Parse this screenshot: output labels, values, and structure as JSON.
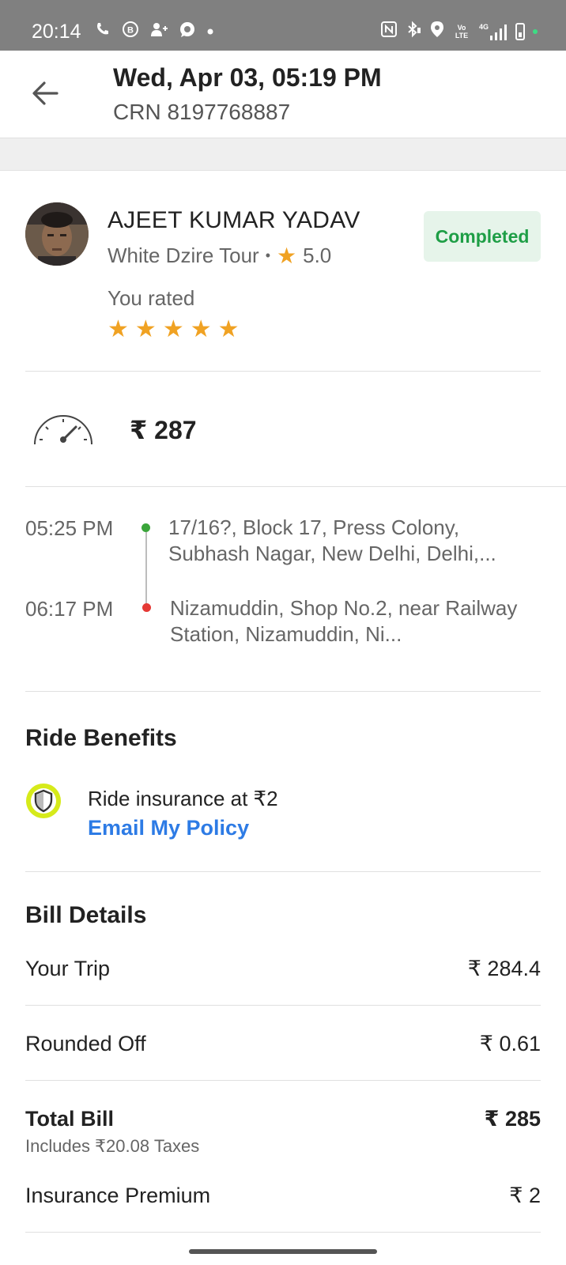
{
  "status_bar": {
    "time": "20:14",
    "icons_left": [
      "phone-icon",
      "b-badge-icon",
      "person-add-icon",
      "whatsapp-icon",
      "dot-icon"
    ],
    "icons_right": [
      "nfc-icon",
      "bluetooth-icon",
      "location-icon",
      "volte-icon",
      "signal-icon",
      "battery-icon"
    ],
    "volte_label": "Vo LTE",
    "network_label": "4G"
  },
  "header": {
    "title": "Wed, Apr 03, 05:19 PM",
    "subtitle": "CRN 8197768887"
  },
  "driver": {
    "name": "AJEET KUMAR YADAV",
    "car": "White Dzire Tour",
    "separator": "•",
    "rating": "5.0",
    "status": "Completed",
    "you_rated_label": "You rated",
    "user_rating_stars": 5
  },
  "fare": {
    "amount": "₹ 287"
  },
  "route": {
    "pickup_time": "05:25 PM",
    "pickup_address": "17/16?, Block 17, Press Colony, Subhash Nagar, New Delhi, Delhi,...",
    "drop_time": "06:17 PM",
    "drop_address": "Nizamuddin, Shop No.2, near Railway Station, Nizamuddin, Ni...",
    "pickup_color": "#3aa53a",
    "drop_color": "#e53935"
  },
  "benefits": {
    "title": "Ride Benefits",
    "insurance_text": "Ride insurance at ₹2",
    "link_label": "Email My Policy"
  },
  "bill": {
    "title": "Bill Details",
    "rows": [
      {
        "label": "Your Trip",
        "value": "₹ 284.4"
      },
      {
        "label": "Rounded Off",
        "value": "₹ 0.61"
      },
      {
        "label": "Total Bill",
        "value": "₹ 285"
      },
      {
        "label": "Insurance Premium",
        "value": "₹ 2"
      }
    ],
    "taxes_note": "Includes ₹20.08 Taxes"
  },
  "colors": {
    "status_bar": "#808080",
    "accent_link": "#2d7be5",
    "star": "#f0a223",
    "badge_bg": "#e6f4ea",
    "badge_text": "#1e9e46"
  }
}
